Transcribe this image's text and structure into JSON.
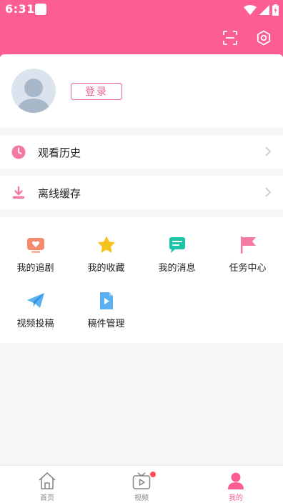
{
  "status_bar": {
    "time": "6:31",
    "icons": [
      "notification-square-icon",
      "wifi-icon",
      "signal-icon",
      "battery-charging-icon"
    ]
  },
  "header": {
    "scan_icon": "scan-icon",
    "settings_icon": "gear-icon",
    "background_color": "#fd5e92"
  },
  "profile": {
    "login_label": "登录",
    "avatar_icon": "default-avatar-icon"
  },
  "list": [
    {
      "label": "观看历史",
      "icon": "clock-icon",
      "color": "#f47aa4"
    },
    {
      "label": "离线缓存",
      "icon": "download-icon",
      "color": "#f47aa4"
    }
  ],
  "grid": [
    {
      "label": "我的追剧",
      "icon": "tv-heart-icon",
      "color": "#f68a6c"
    },
    {
      "label": "我的收藏",
      "icon": "star-icon",
      "color": "#f7c21e"
    },
    {
      "label": "我的消息",
      "icon": "message-icon",
      "color": "#1cc4a8"
    },
    {
      "label": "任务中心",
      "icon": "flag-icon",
      "color": "#f47aa4"
    },
    {
      "label": "视频投稿",
      "icon": "paper-plane-icon",
      "color": "#5ab0f0"
    },
    {
      "label": "稿件管理",
      "icon": "video-file-icon",
      "color": "#5ab0f0"
    }
  ],
  "tabs": [
    {
      "label": "首页",
      "icon": "home-icon",
      "active": false
    },
    {
      "label": "视频",
      "icon": "tv-play-icon",
      "active": false,
      "badge": true
    },
    {
      "label": "我的",
      "icon": "person-icon",
      "active": true
    }
  ],
  "accent_color": "#fd5e92"
}
